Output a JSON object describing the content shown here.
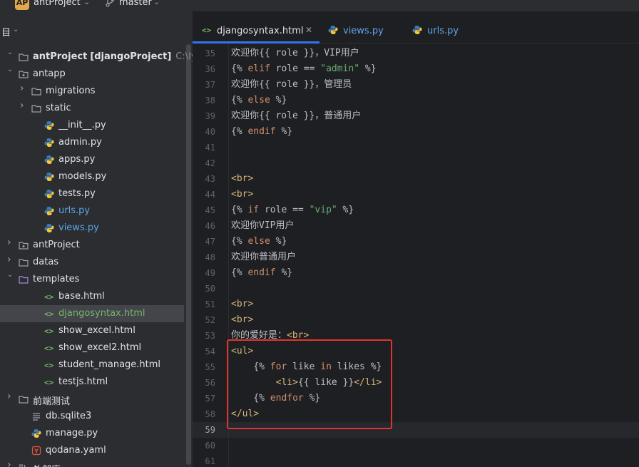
{
  "topbar": {
    "project_badge": "AP",
    "project_name": "antProject",
    "branch": "master"
  },
  "sidebar": {
    "header": "目",
    "items": [
      {
        "label": "antProject",
        "suffix": "[djangoProject]",
        "path": "C:\\lyhwork\\",
        "icon": "folder-icon"
      },
      {
        "label": "antapp",
        "icon": "package-icon"
      },
      {
        "label": "migrations",
        "icon": "folder-icon"
      },
      {
        "label": "static",
        "icon": "folder-icon"
      },
      {
        "label": "__init__.py",
        "icon": "python-icon"
      },
      {
        "label": "admin.py",
        "icon": "python-icon"
      },
      {
        "label": "apps.py",
        "icon": "python-icon"
      },
      {
        "label": "models.py",
        "icon": "python-icon"
      },
      {
        "label": "tests.py",
        "icon": "python-icon"
      },
      {
        "label": "urls.py",
        "icon": "python-icon"
      },
      {
        "label": "views.py",
        "icon": "python-icon"
      },
      {
        "label": "antProject",
        "icon": "package-icon"
      },
      {
        "label": "datas",
        "icon": "folder-icon"
      },
      {
        "label": "templates",
        "icon": "folder-purple-icon"
      },
      {
        "label": "base.html",
        "icon": "html-icon"
      },
      {
        "label": "djangosyntax.html",
        "icon": "html-icon"
      },
      {
        "label": "show_excel.html",
        "icon": "html-icon"
      },
      {
        "label": "show_excel2.html",
        "icon": "html-icon"
      },
      {
        "label": "student_manage.html",
        "icon": "html-icon"
      },
      {
        "label": "testjs.html",
        "icon": "html-icon"
      },
      {
        "label": "前端测试",
        "icon": "folder-icon"
      },
      {
        "label": "db.sqlite3",
        "icon": "database-icon"
      },
      {
        "label": "manage.py",
        "icon": "python-icon"
      },
      {
        "label": "qodana.yaml",
        "icon": "yaml-icon"
      },
      {
        "label": "外部库",
        "icon": "library-icon"
      }
    ]
  },
  "tabs": [
    {
      "label": "djangosyntax.html",
      "icon": "html-icon",
      "active": true
    },
    {
      "label": "views.py",
      "icon": "python-icon"
    },
    {
      "label": "urls.py",
      "icon": "python-icon"
    }
  ],
  "editor": {
    "line_numbers": [
      "35",
      "36",
      "37",
      "38",
      "39",
      "40",
      "41",
      "42",
      "43",
      "44",
      "45",
      "46",
      "47",
      "48",
      "49",
      "50",
      "51",
      "52",
      "53",
      "54",
      "55",
      "56",
      "57",
      "58",
      "59",
      "60",
      "61"
    ],
    "lines": {
      "l35": "欢迎你{{ role }}，VIP用户",
      "l36a": "{% ",
      "l36b": "elif",
      "l36c": " role == ",
      "l36d": "\"admin\"",
      "l36e": " %}",
      "l37": "欢迎你{{ role }}，管理员",
      "l38a": "{% ",
      "l38b": "else",
      "l38c": " %}",
      "l39": "欢迎你{{ role }}，普通用户",
      "l40a": "{% ",
      "l40b": "endif",
      "l40c": " %}",
      "l43": "<br>",
      "l44": "<br>",
      "l45a": "{% ",
      "l45b": "if",
      "l45c": " role == ",
      "l45d": "\"vip\"",
      "l45e": " %}",
      "l46": "欢迎你VIP用户",
      "l47a": "{% ",
      "l47b": "else",
      "l47c": " %}",
      "l48": "欢迎你普通用户",
      "l49a": "{% ",
      "l49b": "endif",
      "l49c": " %}",
      "l51": "<br>",
      "l52": "<br>",
      "l53a": "你的爱好是：",
      "l53b": "<br>",
      "l54": "<ul>",
      "l55a": "    {% ",
      "l55b": "for",
      "l55c": " like ",
      "l55d": "in",
      "l55e": " likes %}",
      "l56a": "        ",
      "l56b": "<li>",
      "l56c": "{{ like }}",
      "l56d": "</li>",
      "l57a": "    {% ",
      "l57b": "endfor",
      "l57c": " %}",
      "l58": "</ul>"
    },
    "current_line": "59"
  },
  "colors": {
    "tag": "#d5b778",
    "keyword": "#cf8e6d",
    "string": "#6aab73",
    "highlight_box": "#e5322d",
    "accent": "#3574f0"
  }
}
